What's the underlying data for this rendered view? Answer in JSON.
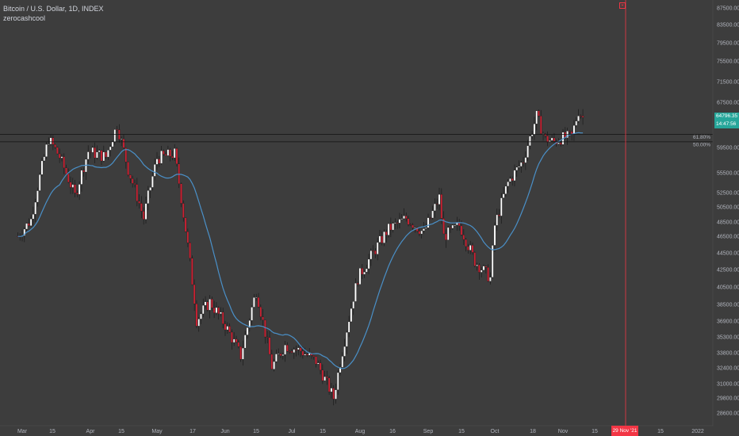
{
  "header": {
    "symbol_title": "Bitcoin / U.S. Dollar, 1D, INDEX",
    "author": "zerocashcool"
  },
  "price_badge": {
    "price": "64796.35",
    "countdown": "14:47:56"
  },
  "date_badge": "29 Nov '21",
  "marker_icon": "x-marker-icon",
  "colors": {
    "background": "#3d3d3d",
    "up": "#ffffff",
    "down": "#cc2233",
    "ma": "#4a90c8",
    "accent": "#26a69a",
    "marker": "#f23645"
  },
  "chart_data": {
    "type": "candlestick",
    "y_axis_labels": [
      "87500.00",
      "83500.00",
      "79500.00",
      "75500.00",
      "71500.00",
      "67500.00",
      "59500.00",
      "55500.00",
      "52500.00",
      "50500.00",
      "48500.00",
      "46500.00",
      "44500.00",
      "42500.00",
      "40500.00",
      "38500.00",
      "36900.00",
      "35300.00",
      "33800.00",
      "32400.00",
      "31000.00",
      "29800.00",
      "28600.00"
    ],
    "x_axis_labels": [
      "Mar",
      "15",
      "Apr",
      "15",
      "May",
      "17",
      "Jun",
      "15",
      "Jul",
      "15",
      "Aug",
      "16",
      "Sep",
      "15",
      "Oct",
      "18",
      "Nov",
      "15",
      "15",
      "2022"
    ],
    "fib_levels": [
      {
        "label": "61.80%",
        "price": 61800
      },
      {
        "label": "50.00%",
        "price": 60500
      }
    ],
    "ma_series_name": "",
    "close_path": [
      [
        "2021-02-27",
        46500
      ],
      [
        "2021-03-05",
        48800
      ],
      [
        "2021-03-13",
        61000
      ],
      [
        "2021-03-18",
        58000
      ],
      [
        "2021-03-25",
        52000
      ],
      [
        "2021-03-31",
        58900
      ],
      [
        "2021-04-08",
        58000
      ],
      [
        "2021-04-13",
        63500
      ],
      [
        "2021-04-18",
        56000
      ],
      [
        "2021-04-25",
        49000
      ],
      [
        "2021-05-01",
        57800
      ],
      [
        "2021-05-09",
        58500
      ],
      [
        "2021-05-13",
        49500
      ],
      [
        "2021-05-19",
        37000
      ],
      [
        "2021-05-25",
        38800
      ],
      [
        "2021-06-01",
        36500
      ],
      [
        "2021-06-08",
        33500
      ],
      [
        "2021-06-15",
        40000
      ],
      [
        "2021-06-22",
        32500
      ],
      [
        "2021-06-28",
        34500
      ],
      [
        "2021-07-05",
        34000
      ],
      [
        "2021-07-12",
        33000
      ],
      [
        "2021-07-20",
        29800
      ],
      [
        "2021-07-25",
        35000
      ],
      [
        "2021-07-31",
        41500
      ],
      [
        "2021-08-07",
        44500
      ],
      [
        "2021-08-14",
        47500
      ],
      [
        "2021-08-22",
        49000
      ],
      [
        "2021-08-30",
        47000
      ],
      [
        "2021-09-06",
        51800
      ],
      [
        "2021-09-08",
        46500
      ],
      [
        "2021-09-15",
        48000
      ],
      [
        "2021-09-22",
        43500
      ],
      [
        "2021-09-29",
        41500
      ],
      [
        "2021-10-01",
        48000
      ],
      [
        "2021-10-07",
        54000
      ],
      [
        "2021-10-14",
        57500
      ],
      [
        "2021-10-20",
        65000
      ],
      [
        "2021-10-24",
        61000
      ],
      [
        "2021-10-28",
        60500
      ],
      [
        "2021-11-01",
        61200
      ],
      [
        "2021-11-05",
        61500
      ],
      [
        "2021-11-08",
        66000
      ],
      [
        "2021-11-10",
        64796
      ]
    ]
  }
}
